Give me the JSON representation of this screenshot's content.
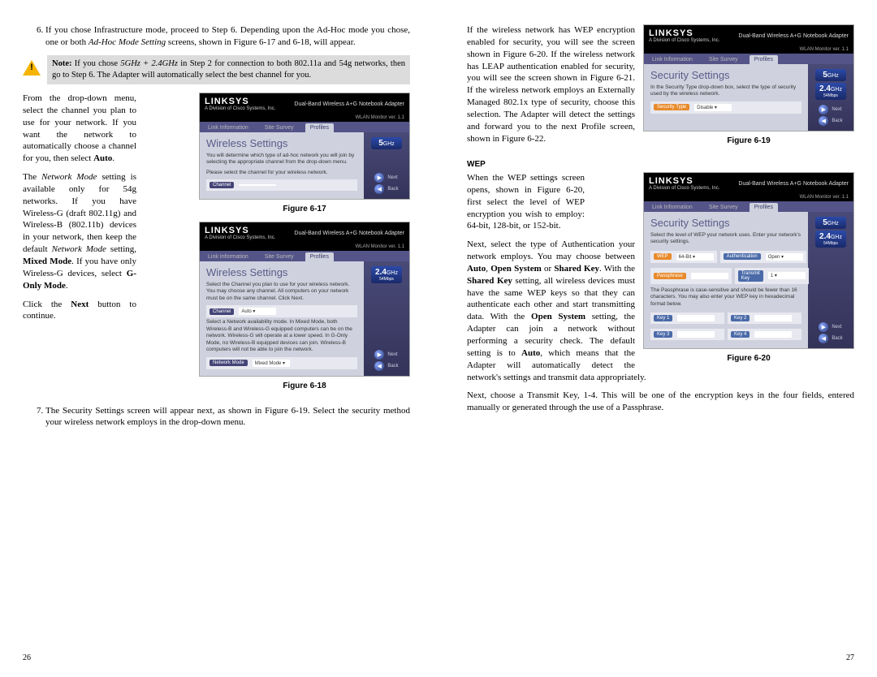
{
  "left": {
    "page_num": "26",
    "li6_a": "If you chose Infrastructure mode, proceed to Step 6. Depending upon the Ad-Hoc mode you chose, one or both ",
    "li6_italic": "Ad-Hoc Mode Setting",
    "li6_b": " screens, shown in Figure 6-17 and 6-18, will appear.",
    "note": {
      "label": "Note:",
      "a": " If you chose ",
      "i1": "5GHz + 2.4GHz",
      "b": " in Step 2 for connection to both 802.11a and 54g networks, then go to Step 6. The Adapter will automatically select the best channel for you."
    },
    "p1": {
      "a": "From the drop-down menu, select the channel you plan to use for your network. If you want the network to automatically choose a channel for you, then select ",
      "b1": "Auto",
      "end": "."
    },
    "p2": {
      "a": "The ",
      "i1": "Network Mode",
      "b": " setting is available only for 54g networks. If you have Wireless-G (draft 802.11g) and Wireless-B (802.11b) devices in your network, then keep the default ",
      "i2": "Network Mode",
      "c": " setting, ",
      "b1": "Mixed Mode",
      "d": ". If you have only Wireless-G devices, select ",
      "b2": "G-Only Mode",
      "end": "."
    },
    "p3": {
      "a": "Click the ",
      "b1": "Next",
      "b": " button to continue."
    },
    "li7": "The Security Settings screen will appear next, as shown in Figure 6-19. Select the security method your wireless network employs in the drop-down menu.",
    "fig17": {
      "caption": "Figure 6-17",
      "logo": "LINKSYS",
      "logosub": "A Division of Cisco Systems, Inc.",
      "prod": "Dual-Band Wireless A+G Notebook Adapter",
      "wlan": "WLAN Monitor  ver. 1.1",
      "tabs": [
        "Link Information",
        "Site Survey",
        "Profiles"
      ],
      "title": "Wireless Settings",
      "desc": "You will determine which type of ad-hoc network you will join by selecting the appropriate channel from the drop-down menu.",
      "desc2": "Please select the channel for your wireless network.",
      "row_label": "Channel",
      "row_value": "",
      "badge1": "5",
      "badge1b": "GHz",
      "nav_next": "Next",
      "nav_back": "Back"
    },
    "fig18": {
      "caption": "Figure 6-18",
      "title": "Wireless Settings",
      "desc": "Select the Channel you plan to use for your wireless network. You may choose any channel. All computers on your network must be on the same channel. Click Next.",
      "row_label": "Channel",
      "row_value": "Auto",
      "desc2": "Select a Network availability mode. In Mixed Mode, both Wireless-B and Wireless-G equipped computers can be on the network. Wireless-G will operate at a lower speed. In G-Only Mode, no Wireless-B equipped devices can join. Wireless-B computers will not be able to join the network.",
      "row2_label": "Network Mode",
      "row2_value": "Mixed Mode",
      "badge1": "2.4",
      "badge1b": "GHz",
      "badge1c": "54Mbps",
      "nav_next": "Next",
      "nav_back": "Back"
    }
  },
  "right": {
    "page_num": "27",
    "p1": "If the wireless network has WEP encryption enabled for security, you will see the screen shown in Figure 6-20. If the wireless network has LEAP authentication enabled for security, you will see the screen shown in Figure 6-21. If the wireless network employs an Externally Managed 802.1x type of security, choose this selection. The Adapter will detect the settings and forward you to the next Profile screen, shown in Figure 6-22.",
    "wep_head": "WEP",
    "p2": "When the WEP settings screen opens, shown in Figure 6-20, first select the level of WEP encryption you wish to employ: 64-bit, 128-bit, or 152-bit.",
    "p3": "Next, select the type of Authentication your network employs. You may choose between ",
    "p3_b1": "Auto",
    "p3_c": ", ",
    "p3_b2": "Open System",
    "p3_d": " or ",
    "p3_b3": "Shared Key",
    "p3_e": ".  With the ",
    "p3_b4": "Shared Key",
    "p3_f": " setting, all wireless devices must have the same WEP keys so that they can authenticate each other and start transmitting data. With the ",
    "p3_b5": "Open System",
    "p3_g": " setting, the Adapter can join a network without performing a security check. The default setting is to ",
    "p3_b6": "Auto",
    "p3_h": ", which means that the Adapter will automatically detect the network's settings and transmit data appropriately.",
    "p4": "Next, choose a Transmit Key, 1-4. This will be one of the encryption keys in the four fields, entered manually or generated through the use of a Passphrase.",
    "fig19": {
      "caption": "Figure 6-19",
      "title": "Security Settings",
      "desc": "In the Security Type drop-down box, select the type of security used by the wireless network.",
      "row_label": "Security Type",
      "row_value": "Disable",
      "badge1": "5",
      "badge1b": "GHz",
      "badge2": "2.4",
      "badge2b": "GHz",
      "badge2c": "54Mbps",
      "nav_next": "Next",
      "nav_back": "Back"
    },
    "fig20": {
      "caption": "Figure 6-20",
      "title": "Security Settings",
      "desc": "Select the level of WEP your network uses. Enter your network's security settings.",
      "wep_label": "WEP",
      "wep_value": "64-Bit",
      "auth_label": "Authentication",
      "auth_value": "Open",
      "pass_label": "Passphrase",
      "tx_label": "Transmit Key",
      "tx_value": "1",
      "desc2": "The Passphrase is case-sensitive and should be fewer than 16 characters. You may also enter your WEP key in hexadecimal format below.",
      "k1": "Key 1",
      "k2": "Key 2",
      "k3": "Key 3",
      "k4": "Key 4",
      "badge1": "5",
      "badge1b": "GHz",
      "badge2": "2.4",
      "badge2b": "GHz",
      "badge2c": "54Mbps",
      "nav_next": "Next",
      "nav_back": "Back"
    }
  },
  "common": {
    "logo": "LINKSYS",
    "logosub": "A Division of Cisco Systems, Inc.",
    "prod": "Dual-Band Wireless A+G Notebook Adapter",
    "wlan": "WLAN Monitor  ver. 1.1",
    "tabs": [
      "Link Information",
      "Site Survey",
      "Profiles"
    ]
  }
}
